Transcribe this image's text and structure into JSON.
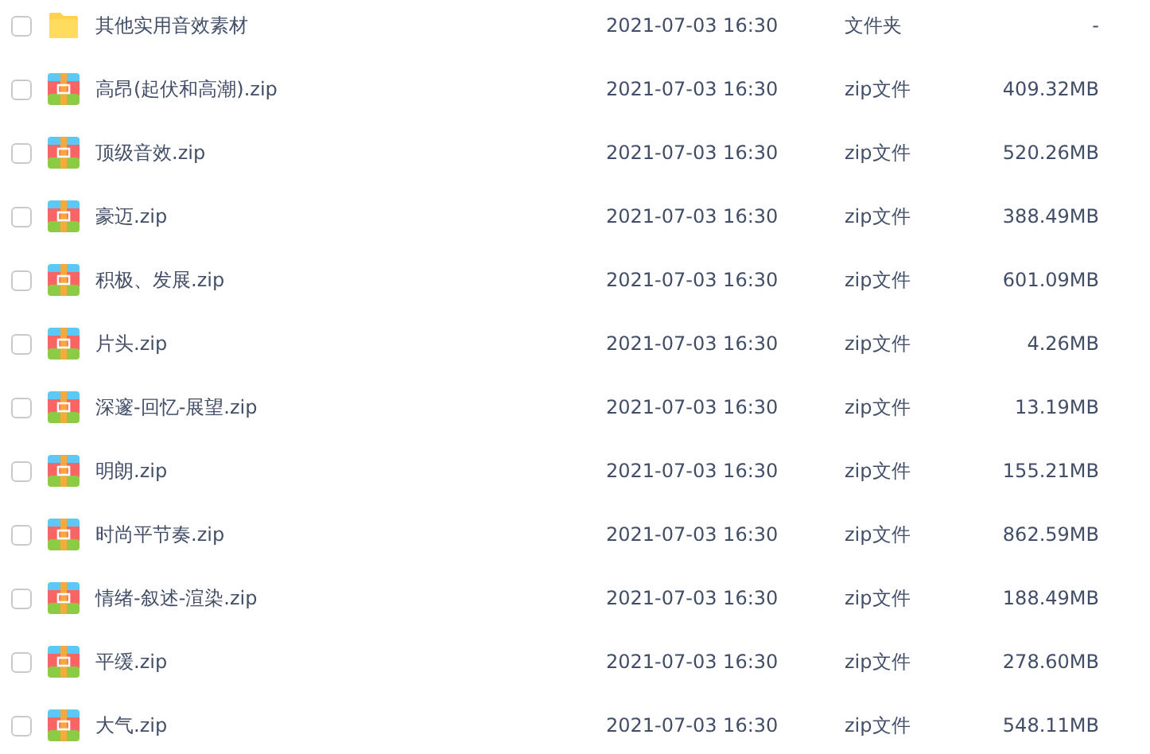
{
  "files": [
    {
      "kind": "folder",
      "checked": false,
      "name": "其他实用音效素材",
      "modified": "2021-07-03 16:30",
      "type": "文件夹",
      "size": "-"
    },
    {
      "kind": "zip",
      "checked": false,
      "name": "高昂(起伏和高潮).zip",
      "modified": "2021-07-03 16:30",
      "type": "zip文件",
      "size": "409.32MB"
    },
    {
      "kind": "zip",
      "checked": false,
      "name": "顶级音效.zip",
      "modified": "2021-07-03 16:30",
      "type": "zip文件",
      "size": "520.26MB"
    },
    {
      "kind": "zip",
      "checked": false,
      "name": "豪迈.zip",
      "modified": "2021-07-03 16:30",
      "type": "zip文件",
      "size": "388.49MB"
    },
    {
      "kind": "zip",
      "checked": false,
      "name": "积极、发展.zip",
      "modified": "2021-07-03 16:30",
      "type": "zip文件",
      "size": "601.09MB"
    },
    {
      "kind": "zip",
      "checked": false,
      "name": "片头.zip",
      "modified": "2021-07-03 16:30",
      "type": "zip文件",
      "size": "4.26MB"
    },
    {
      "kind": "zip",
      "checked": false,
      "name": "深邃-回忆-展望.zip",
      "modified": "2021-07-03 16:30",
      "type": "zip文件",
      "size": "13.19MB"
    },
    {
      "kind": "zip",
      "checked": false,
      "name": "明朗.zip",
      "modified": "2021-07-03 16:30",
      "type": "zip文件",
      "size": "155.21MB"
    },
    {
      "kind": "zip",
      "checked": false,
      "name": "时尚平节奏.zip",
      "modified": "2021-07-03 16:30",
      "type": "zip文件",
      "size": "862.59MB"
    },
    {
      "kind": "zip",
      "checked": false,
      "name": "情绪-叙述-渲染.zip",
      "modified": "2021-07-03 16:30",
      "type": "zip文件",
      "size": "188.49MB"
    },
    {
      "kind": "zip",
      "checked": false,
      "name": "平缓.zip",
      "modified": "2021-07-03 16:30",
      "type": "zip文件",
      "size": "278.60MB"
    },
    {
      "kind": "zip",
      "checked": false,
      "name": "大气.zip",
      "modified": "2021-07-03 16:30",
      "type": "zip文件",
      "size": "548.11MB"
    }
  ]
}
